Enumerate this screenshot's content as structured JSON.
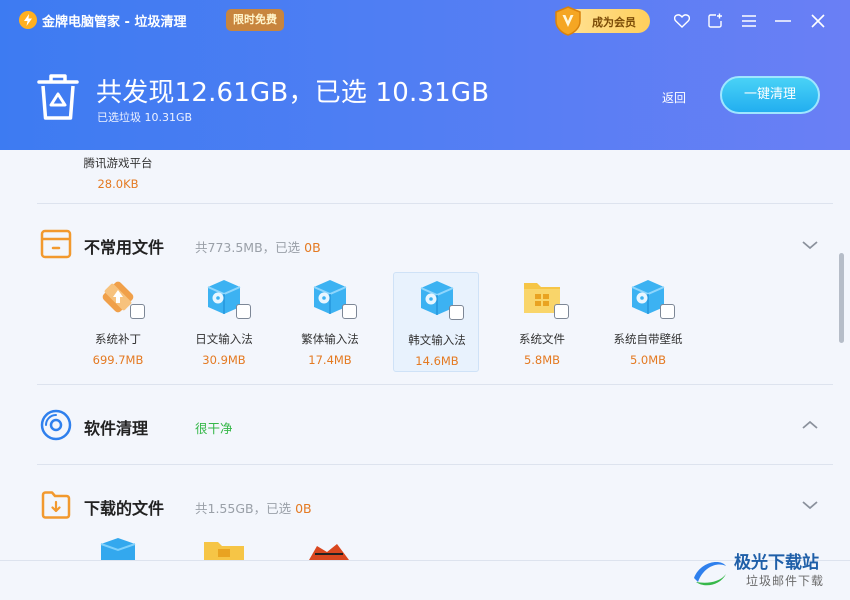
{
  "titlebar": {
    "app_title": "金牌电脑管家 - 垃圾清理",
    "free_badge": "限时免费",
    "vip_label": "成为会员"
  },
  "summary": {
    "headline": "共发现12.61GB，已选 10.31GB",
    "subline": "已选垃圾 10.31GB",
    "back_label": "返回",
    "clean_button": "一键清理"
  },
  "partial_item": {
    "name": "腾讯游戏平台",
    "size": "28.0KB"
  },
  "categories": [
    {
      "title": "不常用文件",
      "meta": "共773.5MB，已选 ",
      "meta_selected": "0B",
      "items": [
        {
          "name": "系统补丁",
          "size": "699.7MB",
          "icon": "patch-icon"
        },
        {
          "name": "日文输入法",
          "size": "30.9MB",
          "icon": "package-box-icon"
        },
        {
          "name": "繁体输入法",
          "size": "17.4MB",
          "icon": "package-box-icon"
        },
        {
          "name": "韩文输入法",
          "size": "14.6MB",
          "icon": "package-box-icon"
        },
        {
          "name": "系统文件",
          "size": "5.8MB",
          "icon": "windows-folder-icon"
        },
        {
          "name": "系统自带壁纸",
          "size": "5.0MB",
          "icon": "package-box-icon"
        }
      ]
    },
    {
      "title": "软件清理",
      "status": "很干净"
    },
    {
      "title": "下载的文件",
      "meta": "共1.55GB，已选 ",
      "meta_selected": "0B"
    }
  ],
  "watermark": {
    "title": "极光下载站",
    "subtitle": "垃圾邮件下载"
  },
  "colors": {
    "header_gradient_start": "#3d7bf2",
    "header_gradient_end": "#6a7ff5",
    "accent_orange": "#e47a22",
    "clean_green": "#37b84a",
    "button_cyan": "#22aef0"
  }
}
